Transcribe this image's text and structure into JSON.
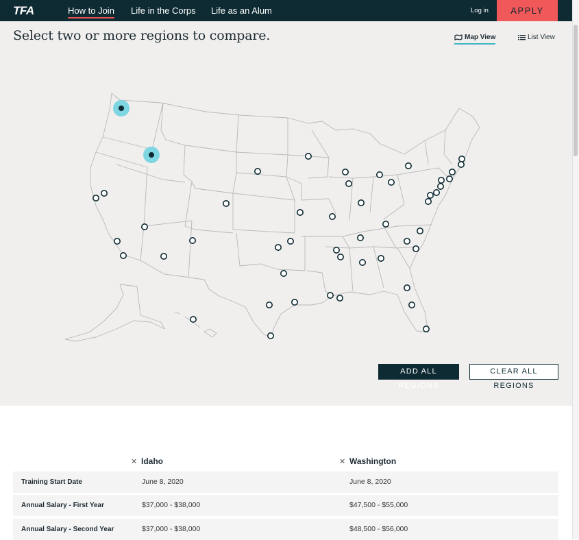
{
  "nav": {
    "logo": "TFA",
    "links": [
      "How to Join",
      "Life in the Corps",
      "Life as an Alum"
    ],
    "login": "Log in",
    "apply": "APPLY"
  },
  "heading": "Select two or more regions to compare.",
  "views": {
    "map": "Map View",
    "list": "List View"
  },
  "buttons": {
    "add_all": "ADD ALL REGIONS",
    "clear_all": "CLEAR ALL REGIONS"
  },
  "compare": {
    "columns": [
      "Idaho",
      "Washington"
    ],
    "rows": [
      {
        "label": "Training Start Date",
        "values": [
          "June 8, 2020",
          "June 8, 2020"
        ]
      },
      {
        "label": "Annual Salary - First Year",
        "values": [
          "$37,000 - $38,000",
          "$47,500 - $55,000"
        ]
      },
      {
        "label": "Annual Salary - Second Year",
        "values": [
          "$37,000 - $38,000",
          "$48,500 - $56,000"
        ]
      }
    ]
  },
  "colors": {
    "nav": "#0e2a33",
    "apply": "#f0585a",
    "selected_halo": "#7fd6e3",
    "map_bg": "#f1efee"
  }
}
